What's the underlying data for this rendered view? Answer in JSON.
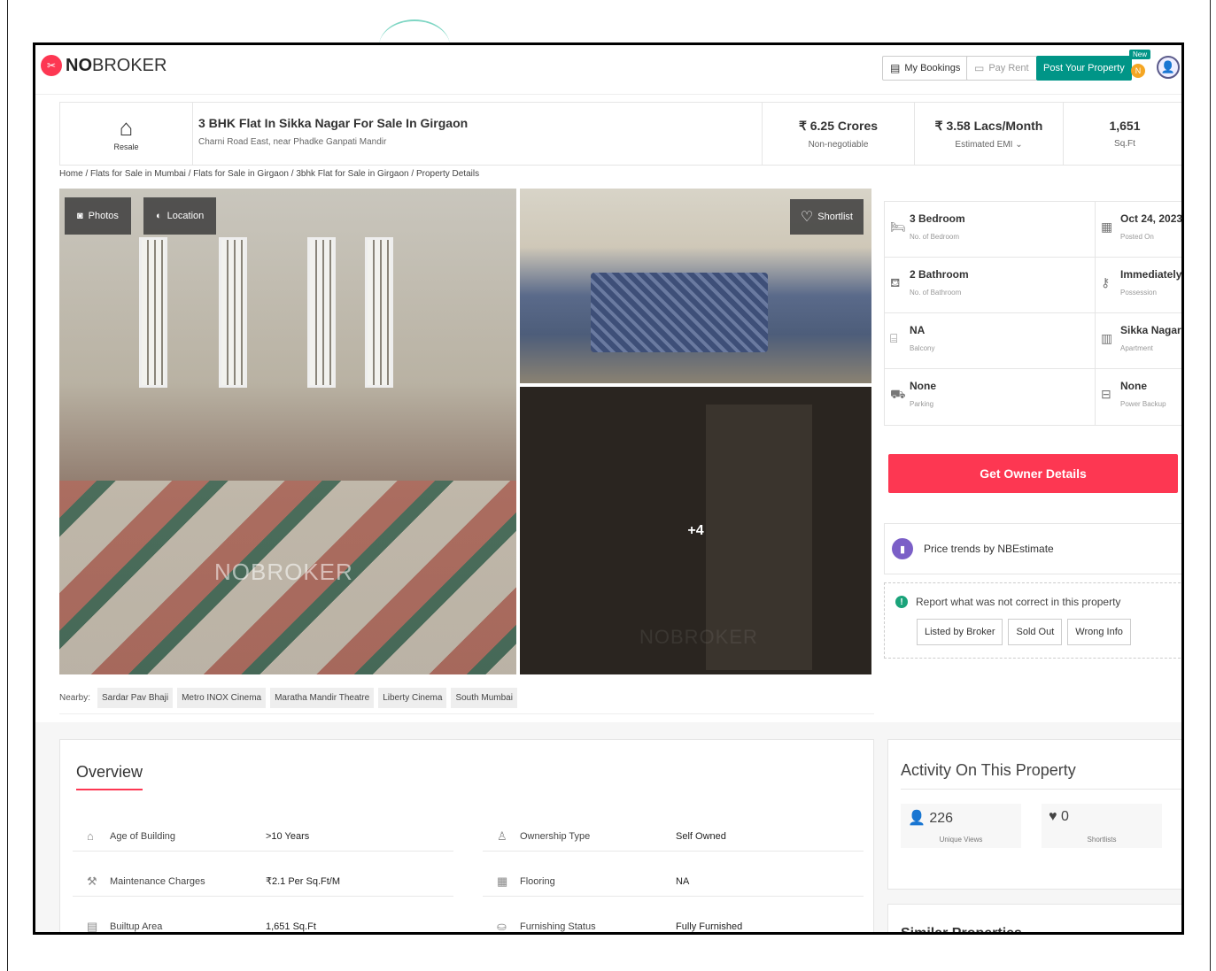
{
  "header": {
    "brand_prefix": "NO",
    "brand_suffix": "BROKER",
    "my_bookings": "My Bookings",
    "pay_rent": "Pay Rent",
    "post_property": "Post Your Property",
    "new_badge": "New",
    "notif_initial": "N"
  },
  "property": {
    "type_label": "Resale",
    "title": "3 BHK Flat In Sikka Nagar For Sale In Girgaon",
    "address": "Charni Road East, near Phadke Ganpati Mandir",
    "price": "₹ 6.25 Crores",
    "price_note": "Non-negotiable",
    "emi": "₹ 3.58 Lacs/Month",
    "emi_note": "Estimated EMI ⌄",
    "area": "1,651",
    "area_unit": "Sq.Ft"
  },
  "breadcrumb": "Home / Flats for Sale in Mumbai / Flats for Sale in Girgaon / 3bhk Flat for Sale in Girgaon / Property Details",
  "gallery": {
    "photos_label": "Photos",
    "location_label": "Location",
    "shortlist_label": "Shortlist",
    "more_count": "+4",
    "watermark": "NOBROKER"
  },
  "nearby": {
    "label": "Nearby:",
    "places": [
      "Sardar Pav Bhaji",
      "Metro INOX Cinema",
      "Maratha Mandir Theatre",
      "Liberty Cinema",
      "South Mumbai"
    ]
  },
  "details": [
    {
      "value": "3 Bedroom",
      "label": "No. of Bedroom",
      "icon": "bed-icon"
    },
    {
      "value": "Oct 24, 2023",
      "label": "Posted On",
      "icon": "calendar-icon"
    },
    {
      "value": "2 Bathroom",
      "label": "No. of Bathroom",
      "icon": "bath-icon"
    },
    {
      "value": "Immediately",
      "label": "Possession",
      "icon": "key-icon"
    },
    {
      "value": "NA",
      "label": "Balcony",
      "icon": "balcony-icon"
    },
    {
      "value": "Sikka Nagar",
      "label": "Apartment",
      "icon": "building-icon"
    },
    {
      "value": "None",
      "label": "Parking",
      "icon": "car-icon"
    },
    {
      "value": "None",
      "label": "Power Backup",
      "icon": "battery-icon"
    }
  ],
  "owner_button": "Get Owner Details",
  "price_trends": "Price trends by NBEstimate",
  "report": {
    "text": "Report what was not correct in this property",
    "options": [
      "Listed by Broker",
      "Sold Out",
      "Wrong Info"
    ]
  },
  "overview": {
    "title": "Overview",
    "rows": [
      {
        "key": "Age of Building",
        "value": ">10 Years",
        "icon": "building-age-icon"
      },
      {
        "key": "Ownership Type",
        "value": "Self Owned",
        "icon": "owner-icon"
      },
      {
        "key": "Maintenance Charges",
        "value": "₹2.1 Per Sq.Ft/M",
        "icon": "tools-icon"
      },
      {
        "key": "Flooring",
        "value": "NA",
        "icon": "flooring-icon"
      },
      {
        "key": "Builtup Area",
        "value": "1,651 Sq.Ft",
        "icon": "area-icon"
      },
      {
        "key": "Furnishing Status",
        "value": "Fully Furnished",
        "icon": "sofa-icon"
      }
    ]
  },
  "activity": {
    "title": "Activity On This Property",
    "views": "226",
    "views_label": "Unique Views",
    "shortlists": "0",
    "shortlists_label": "Shortlists"
  },
  "similar_title": "Similar Properties",
  "colors": {
    "brand_red": "#fd3752",
    "teal": "#009587",
    "purple": "#7b5fc7"
  }
}
